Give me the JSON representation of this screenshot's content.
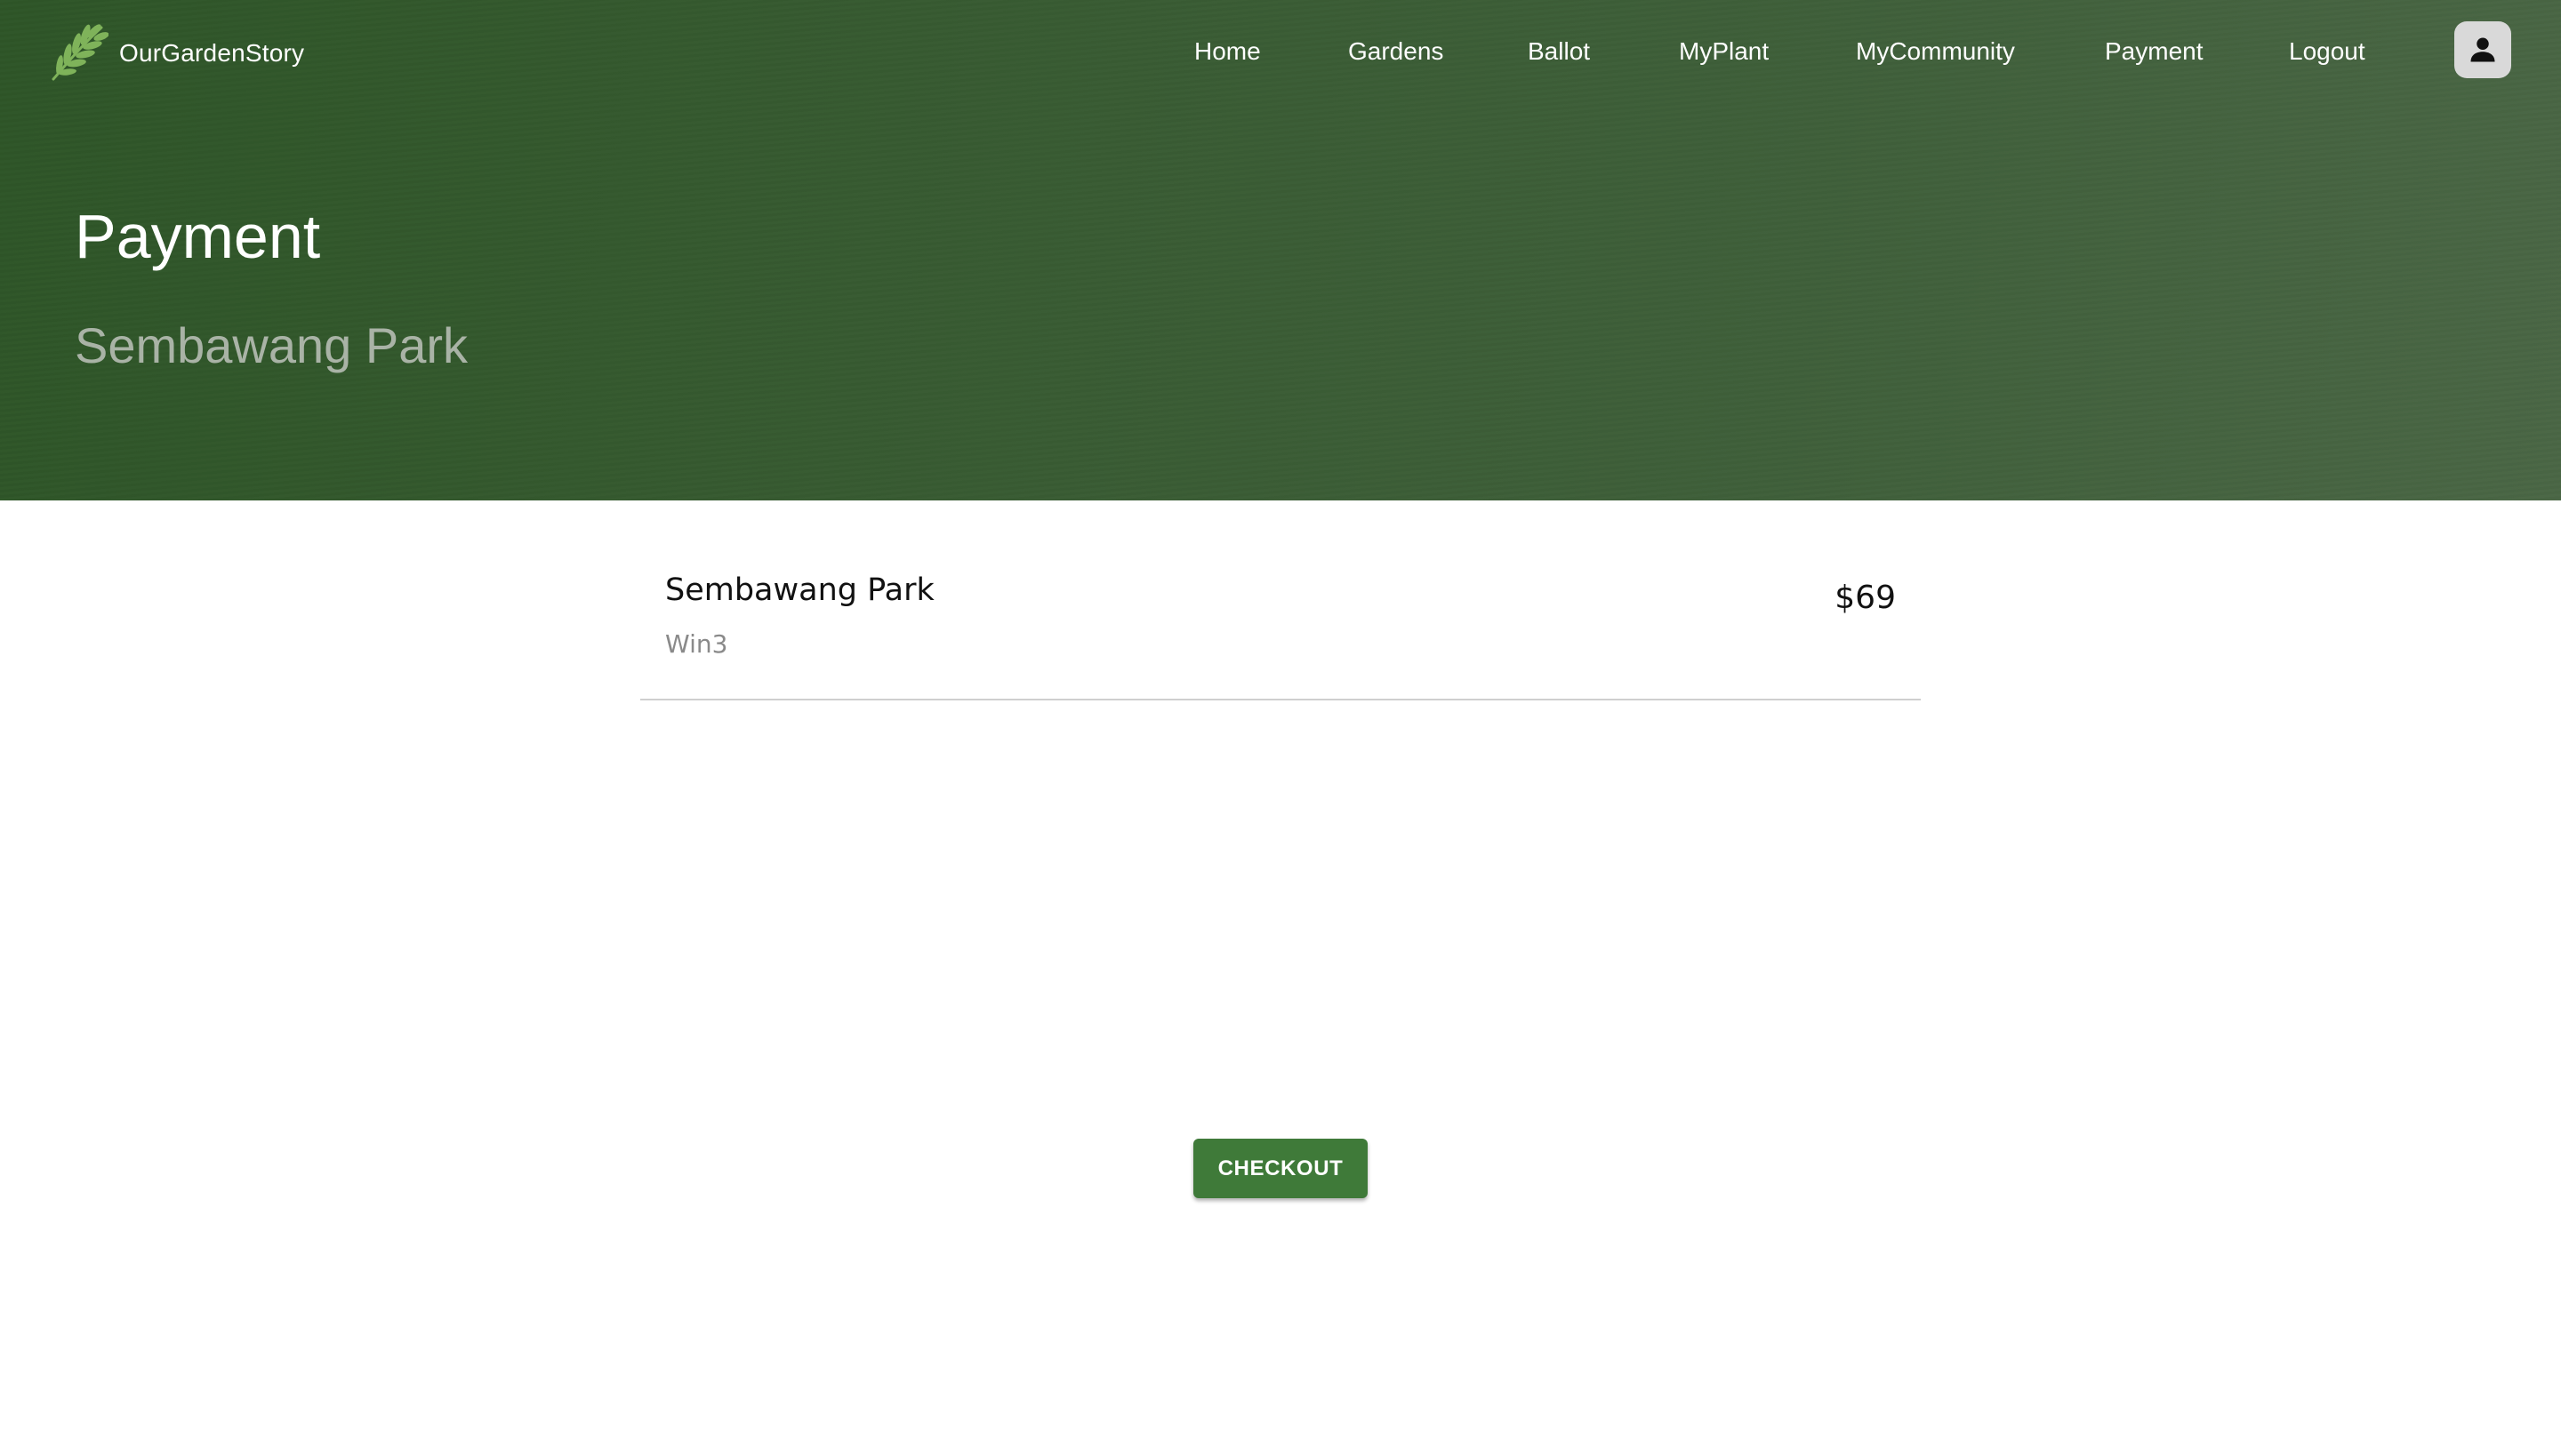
{
  "brand": {
    "name": "OurGardenStory",
    "logo_icon": "leaf-logo-icon"
  },
  "nav": {
    "items": [
      {
        "label": "Home"
      },
      {
        "label": "Gardens"
      },
      {
        "label": "Ballot"
      },
      {
        "label": "MyPlant"
      },
      {
        "label": "MyCommunity"
      },
      {
        "label": "Payment"
      },
      {
        "label": "Logout"
      }
    ],
    "profile_icon": "user-icon"
  },
  "hero": {
    "title": "Payment",
    "subtitle": "Sembawang Park"
  },
  "cart": {
    "items": [
      {
        "name": "Sembawang Park",
        "description": "Win3",
        "price": "$69"
      }
    ]
  },
  "actions": {
    "checkout_label": "CHECKOUT"
  },
  "colors": {
    "hero_green": "#375a31",
    "checkout_green": "#3f7a39",
    "leaf_green": "#7fb35a"
  }
}
